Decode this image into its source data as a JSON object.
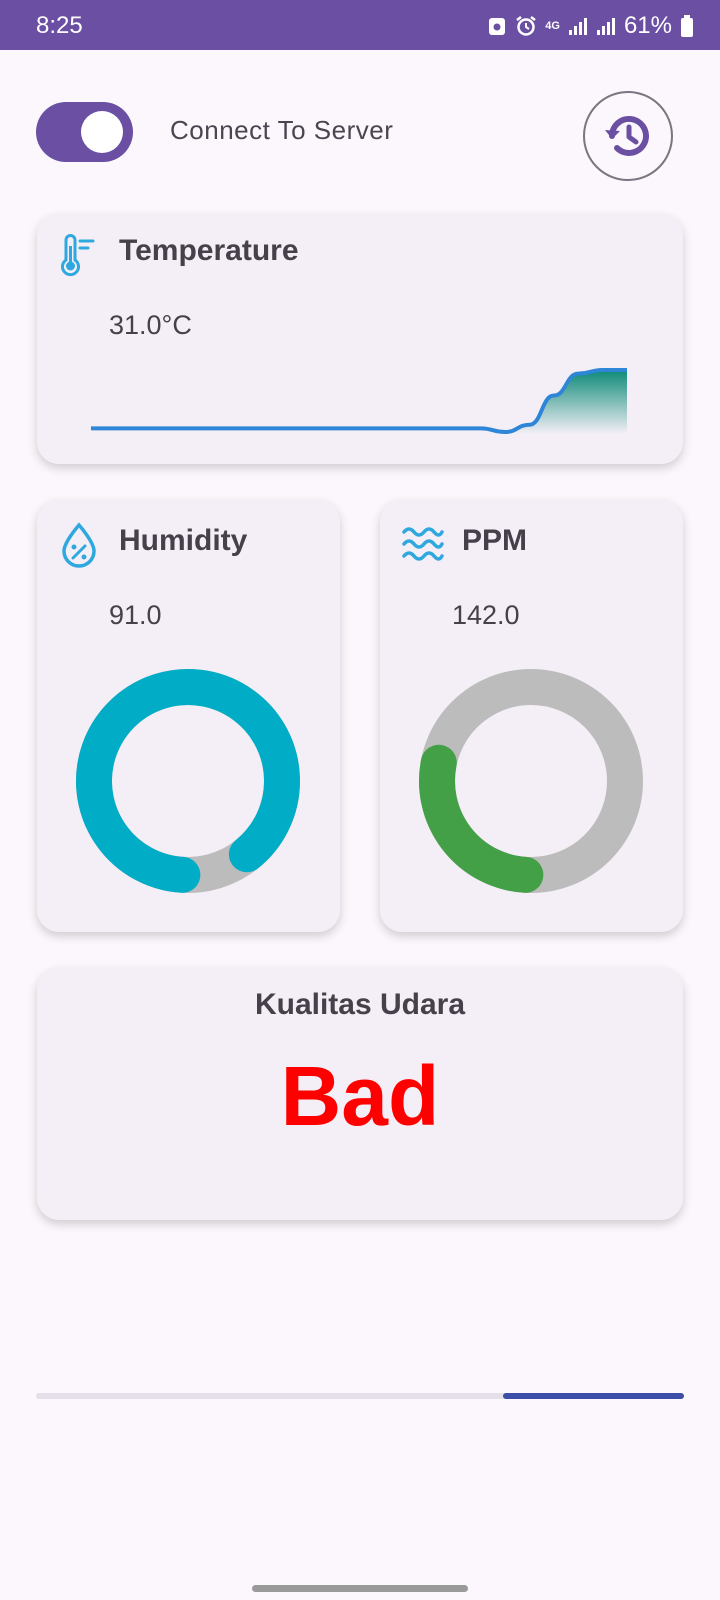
{
  "status_bar": {
    "time": "8:25",
    "network": "4G",
    "battery": "61%",
    "icons": [
      "screenshot-icon",
      "alarm-icon",
      "signal-icon",
      "signal-icon",
      "battery-icon"
    ]
  },
  "header": {
    "server_toggle": {
      "on": true
    },
    "connect_label": "Connect To Server",
    "history_icon": "history-icon"
  },
  "temperature": {
    "title": "Temperature",
    "value": "31.0°C",
    "icon": "thermometer-icon",
    "chart_data": {
      "type": "area",
      "values": [
        29.4,
        29.4,
        29.4,
        29.4,
        29.4,
        29.4,
        29.4,
        29.4,
        29.4,
        29.4,
        29.4,
        29.4,
        29.4,
        29.4,
        29.4,
        29.4,
        29.4,
        29.3,
        29.5,
        30.3,
        30.9,
        31.0,
        31.0
      ]
    }
  },
  "humidity": {
    "title": "Humidity",
    "value": "91.0",
    "icon": "humidity-icon",
    "gauge_fraction": 0.91,
    "color": "#00acc6"
  },
  "ppm": {
    "title": "PPM",
    "value": "142.0",
    "icon": "waves-icon",
    "gauge_fraction": 0.28,
    "color": "#43a047"
  },
  "air_quality": {
    "title": "Kualitas Udara",
    "value": "Bad",
    "color": "#ff0000"
  },
  "progress": {
    "fraction": 0.28
  }
}
